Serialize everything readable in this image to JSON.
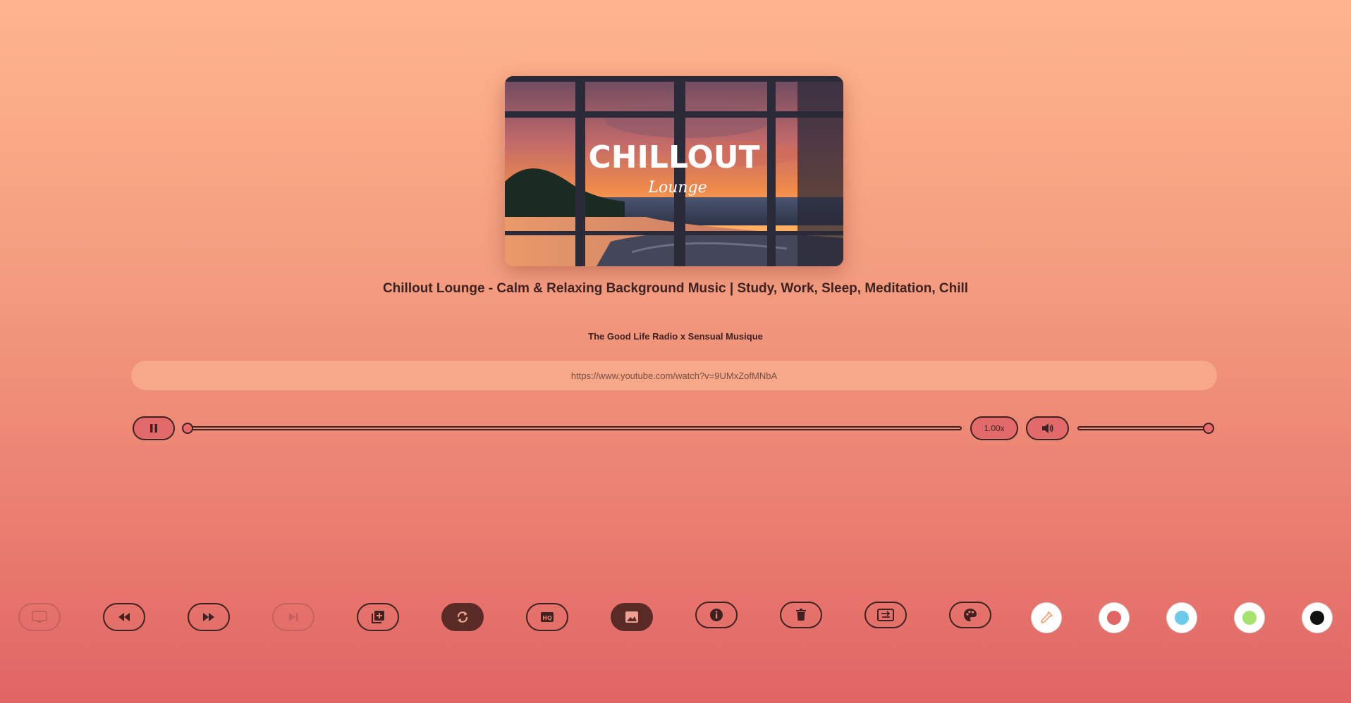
{
  "thumbnail": {
    "headline": "CHILLOUT",
    "script": "Lounge"
  },
  "track": {
    "title": "Chillout Lounge - Calm & Relaxing Background Music | Study, Work, Sleep, Meditation, Chill",
    "artist": "The Good Life Radio x Sensual Musique"
  },
  "url_input": {
    "value": "https://www.youtube.com/watch?v=9UMxZofMNbA"
  },
  "player": {
    "play_state_icon": "pause-icon",
    "progress_fraction": 0.0,
    "speed_label": "1.00x",
    "volume_icon": "volume-icon",
    "volume_fraction": 1.0
  },
  "toolbar": [
    {
      "icon": "screen-icon",
      "state": "disabled"
    },
    {
      "icon": "rewind-icon",
      "state": "normal"
    },
    {
      "icon": "fast-forward-icon",
      "state": "normal"
    },
    {
      "icon": "skip-next-icon",
      "state": "disabled"
    },
    {
      "icon": "add-to-queue-icon",
      "state": "normal"
    },
    {
      "icon": "repeat-icon",
      "state": "active"
    },
    {
      "icon": "hq-icon",
      "state": "normal"
    },
    {
      "icon": "image-icon",
      "state": "active"
    },
    {
      "icon": "info-icon",
      "state": "normal"
    },
    {
      "icon": "trash-icon",
      "state": "normal"
    },
    {
      "icon": "transfer-icon",
      "state": "normal"
    },
    {
      "icon": "palette-icon",
      "state": "normal"
    }
  ],
  "colors": {
    "picker_icon": "eyedropper-icon",
    "swatches": [
      "#e06666",
      "#6cc9e8",
      "#a6e36e",
      "#111111"
    ]
  }
}
